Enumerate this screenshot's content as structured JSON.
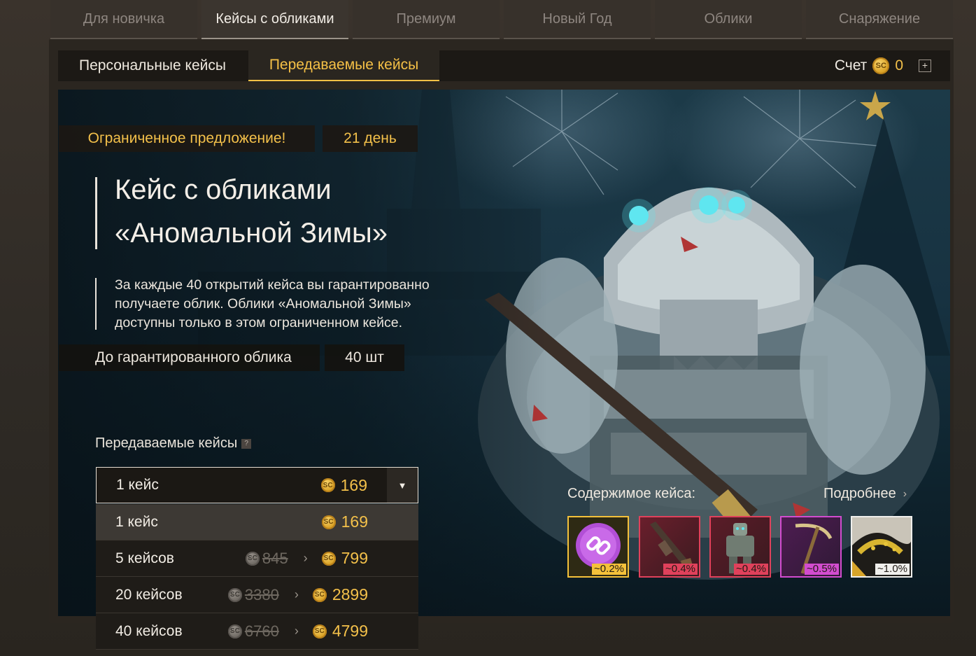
{
  "top_tabs": [
    {
      "label": "Для новичка"
    },
    {
      "label": "Кейсы с обликами"
    },
    {
      "label": "Премиум"
    },
    {
      "label": "Новый Год"
    },
    {
      "label": "Облики"
    },
    {
      "label": "Снаряжение"
    }
  ],
  "sub_tabs": {
    "personal": "Персональные кейсы",
    "transfer": "Передаваемые кейсы"
  },
  "account": {
    "label": "Счет",
    "balance": "0",
    "plus": "+"
  },
  "offer": {
    "limited": "Ограниченное предложение!",
    "days": "21 день",
    "title_line1": "Кейс с обликами",
    "title_line2": "«Аномальной Зимы»",
    "desc_line1": "За каждые 40 открытий кейса вы гарантированно",
    "desc_line2": "получаете облик. Облики «Аномальной Зимы»",
    "desc_line3": "доступны только в этом ограниченном кейсе.",
    "guarantee_label": "До гарантированного облика",
    "guarantee_value": "40 шт"
  },
  "transfer_cases": {
    "label": "Передаваемые кейсы",
    "help": "?",
    "selected": {
      "label": "1 кейс",
      "price": "169"
    },
    "options": [
      {
        "label": "1 кейс",
        "old_price": "",
        "price": "169"
      },
      {
        "label": "5 кейсов",
        "old_price": "845",
        "price": "799"
      },
      {
        "label": "20 кейсов",
        "old_price": "3380",
        "price": "2899"
      },
      {
        "label": "40 кейсов",
        "old_price": "6760",
        "price": "4799"
      }
    ]
  },
  "contents": {
    "label": "Содержимое кейса:",
    "more": "Подробнее",
    "items": [
      {
        "icon": "chain-link-icon",
        "chance": "~0.2%",
        "color": "#f4c13a"
      },
      {
        "icon": "rifle-icon",
        "chance": "~0.4%",
        "color": "#e0415b"
      },
      {
        "icon": "armor-suit-icon",
        "chance": "~0.4%",
        "color": "#e0415b"
      },
      {
        "icon": "scythe-icon",
        "chance": "~0.5%",
        "color": "#d24ccf"
      },
      {
        "icon": "camo-pattern-icon",
        "chance": "~1.0%",
        "color": "#f0efec"
      }
    ]
  },
  "colors": {
    "accent": "#f5c046",
    "legendary": "#f4c13a",
    "epic": "#e0415b",
    "rare": "#d24ccf",
    "common": "#f0efec"
  }
}
